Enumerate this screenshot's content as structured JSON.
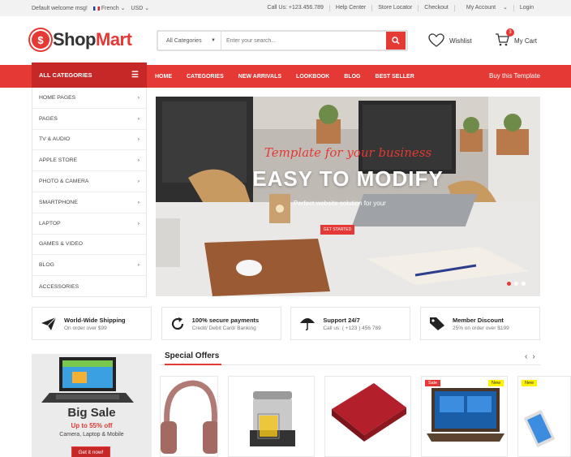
{
  "topbar": {
    "welcome": "Default welcome msg!",
    "language": "French",
    "currency": "USD",
    "links": [
      "Call Us: +123.456.789",
      "Help Center",
      "Store Locator",
      "Checkout",
      "My Account",
      "Login"
    ]
  },
  "header": {
    "logo_prefix": "Shop",
    "logo_suffix": "Mart",
    "search_category": "All Categories",
    "search_placeholder": "Enter your search...",
    "wishlist": "Wishlist",
    "cart_label": "My Cart",
    "cart_count": "3"
  },
  "nav": {
    "all_categories": "ALL CATEGORIES",
    "items": [
      "HOME",
      "CATEGORIES",
      "NEW ARRIVALS",
      "LOOKBOOK",
      "BLOG",
      "BEST SELLER"
    ],
    "buy": "Buy this Template"
  },
  "sidebar": {
    "items": [
      {
        "label": "HOME PAGES",
        "arrow": true
      },
      {
        "label": "PAGES",
        "arrow": true
      },
      {
        "label": "TV & AUDIO",
        "arrow": true
      },
      {
        "label": "APPLE STORE",
        "arrow": true
      },
      {
        "label": "PHOTO & CAMERA",
        "arrow": true
      },
      {
        "label": "SMARTPHONE",
        "arrow": true
      },
      {
        "label": "LAPTOP",
        "arrow": true
      },
      {
        "label": "GAMES & VIDEO",
        "arrow": false
      },
      {
        "label": "BLOG",
        "arrow": true
      },
      {
        "label": "ACCESSORIES",
        "arrow": false
      }
    ]
  },
  "banner": {
    "script": "Template for your business",
    "title": "EASY TO MODIFY",
    "subtitle": "Perfect website solution for your",
    "button": "GET STARTED"
  },
  "features": [
    {
      "title": "World-Wide Shipping",
      "sub": "On order over $99",
      "icon": "paper-plane-icon"
    },
    {
      "title": "100% secure payments",
      "sub": "Credit/ Debit Card/ Banking",
      "icon": "refresh-icon"
    },
    {
      "title": "Support 24/7",
      "sub": "Call us: ( +123 ) 456 789",
      "icon": "umbrella-icon"
    },
    {
      "title": "Member Discount",
      "sub": "25% on order over $199",
      "icon": "tag-icon"
    }
  ],
  "promo": {
    "title": "Big Sale",
    "off": "Up to 55% off",
    "categories": "Camera, Laptop & Mobile",
    "button": "Get it now!"
  },
  "special_offers": {
    "title": "Special Offers",
    "tags": {
      "sale": "Sale",
      "new": "New"
    }
  },
  "colors": {
    "accent": "#e53935",
    "accent_dark": "#c62828"
  }
}
